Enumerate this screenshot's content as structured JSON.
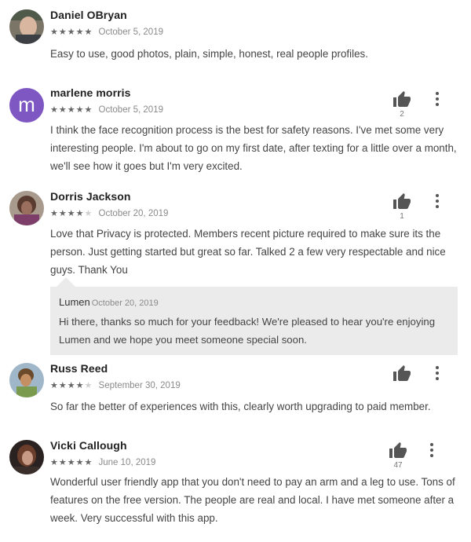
{
  "reviews": [
    {
      "name": "Daniel OBryan",
      "stars": "★★★★★",
      "stars_off": "",
      "date": "October 5, 2019",
      "text": "Easy to use, good photos, plain, simple, honest, real people profiles."
    },
    {
      "name": "marlene morris",
      "avatar_letter": "m",
      "stars": "★★★★★",
      "stars_off": "",
      "date": "October 5, 2019",
      "helpful_count": "2",
      "text": "I think the face recognition process is the best for safety reasons. I've met some very interesting people. I'm about to go on my first date, after texting for a little over a month, we'll see how it goes but I'm very excited."
    },
    {
      "name": "Dorris Jackson",
      "stars": "★★★★",
      "stars_off": "★",
      "date": "October 20, 2019",
      "helpful_count": "1",
      "text": "Love that Privacy is protected. Members recent picture required to make sure its the person. Just getting started but great so far. Talked 2 a few very respectable and nice guys. Thank You",
      "reply": {
        "author": "Lumen",
        "date": "October 20, 2019",
        "text": "Hi there, thanks so much for your feedback! We're pleased to hear you're enjoying Lumen and we hope you meet someone special soon."
      }
    },
    {
      "name": "Russ Reed",
      "stars": "★★★★",
      "stars_off": "★",
      "date": "September 30, 2019",
      "text": "So far the better of experiences with this, clearly worth upgrading to paid member."
    },
    {
      "name": "Vicki Callough",
      "stars": "★★★★★",
      "stars_off": "",
      "date": "June 10, 2019",
      "helpful_count": "47",
      "text": "Wonderful user friendly app that you don't need to pay an arm and a leg to use. Tons of features on the free version. The people are real and local. I have met someone after a week. Very successful with this app."
    }
  ],
  "colors": {
    "letter_avatar_bg": "#7e57c2",
    "reply_bg": "#ebebeb",
    "icon_gray": "#555555"
  },
  "icons": {
    "helpful": "thumb-up-icon",
    "menu": "more-vert-icon"
  }
}
